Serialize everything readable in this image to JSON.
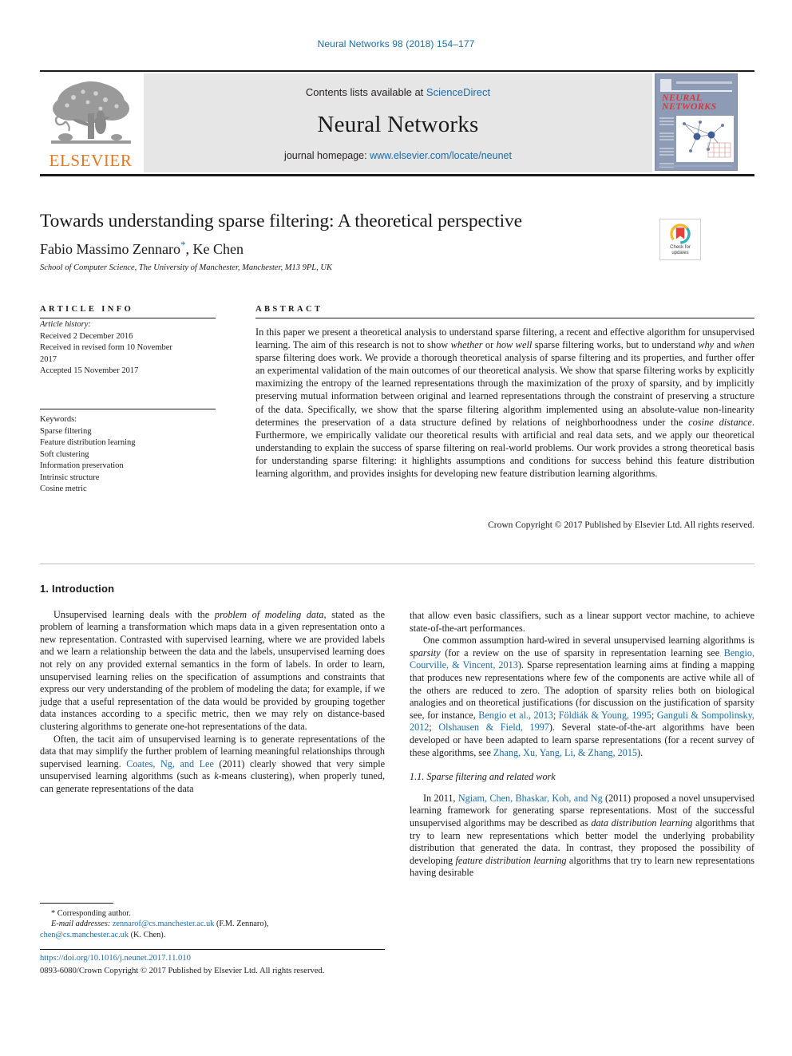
{
  "running_head": "Neural Networks 98 (2018) 154–177",
  "masthead": {
    "contents_prefix": "Contents lists available at ",
    "contents_link": "ScienceDirect",
    "journal_title": "Neural Networks",
    "homepage_prefix": "journal homepage: ",
    "homepage_url": "www.elsevier.com/locate/neunet",
    "publisher_logo_text": "ELSEVIER",
    "cover_title": "NEURAL NETWORKS"
  },
  "article": {
    "title": "Towards understanding sparse filtering: A theoretical perspective",
    "authors": "Fabio Massimo Zennaro",
    "corresponding_marker": "*",
    "authors_tail": ", Ke Chen",
    "affiliation": "School of Computer Science, The University of Manchester, Manchester, M13 9PL, UK",
    "crossmark_line1": "Check for",
    "crossmark_line2": "updates"
  },
  "article_info": {
    "heading": "ARTICLE INFO",
    "history_label": "Article history:",
    "history": [
      "Received 2 December 2016",
      "Received in revised form 10 November",
      "2017",
      "Accepted 15 November 2017"
    ],
    "keywords_label": "Keywords:",
    "keywords": [
      "Sparse filtering",
      "Feature distribution learning",
      "Soft clustering",
      "Information preservation",
      "Intrinsic structure",
      "Cosine metric"
    ]
  },
  "abstract": {
    "heading": "ABSTRACT",
    "paragraphs": [
      "In this paper we present a theoretical analysis to understand sparse filtering, a recent and effective algorithm for unsupervised learning. The aim of this research is not to show <i>whether</i> or <i>how well</i> sparse filtering works, but to understand <i>why</i> and <i>when</i> sparse filtering does work. We provide a thorough theoretical analysis of sparse filtering and its properties, and further offer an experimental validation of the main outcomes of our theoretical analysis. We show that sparse filtering works by explicitly maximizing the entropy of the learned representations through the maximization of the proxy of sparsity, and by implicitly preserving mutual information between original and learned representations through the constraint of preserving a structure of the data. Specifically, we show that the sparse filtering algorithm implemented using an absolute-value non-linearity determines the preservation of a data structure defined by relations of neighborhoodness under the <i>cosine distance</i>. Furthermore, we empirically validate our theoretical results with artificial and real data sets, and we apply our theoretical understanding to explain the success of sparse filtering on real-world problems. Our work provides a strong theoretical basis for understanding sparse filtering: it highlights assumptions and conditions for success behind this feature distribution learning algorithm, and provides insights for developing new feature distribution learning algorithms."
    ],
    "copyright": "Crown Copyright © 2017 Published by Elsevier Ltd. All rights reserved."
  },
  "body": {
    "section1_heading": "1. Introduction",
    "left_paragraphs": [
      "Unsupervised learning deals with the <i>problem of modeling data</i>, stated as the problem of learning a transformation which maps data in a given representation onto a new representation. Contrasted with supervised learning, where we are provided labels and we learn a relationship between the data and the labels, unsupervised learning does not rely on any provided external semantics in the form of labels. In order to learn, unsupervised learning relies on the specification of assumptions and constraints that express our very understanding of the problem of modeling the data; for example, if we judge that a useful representation of the data would be provided by grouping together data instances according to a specific metric, then we may rely on distance-based clustering algorithms to generate one-hot representations of the data.",
      "Often, the tacit aim of unsupervised learning is to generate representations of the data that may simplify the further problem of learning meaningful relationships through supervised learning. <span class=\"cit\">Coates, Ng, and Lee</span> (2011) clearly showed that very simple unsupervised learning algorithms (such as <i>k</i>-means clustering), when properly tuned, can generate representations of the data"
    ],
    "right_paragraphs": [
      "that allow even basic classifiers, such as a linear support vector machine, to achieve state-of-the-art performances.",
      "One common assumption hard-wired in several unsupervised learning algorithms is <i>sparsity</i> (for a review on the use of sparsity in representation learning see <span class=\"cit\">Bengio, Courville, &amp; Vincent, 2013</span>). Sparse representation learning aims at finding a mapping that produces new representations where few of the components are active while all of the others are reduced to zero. The adoption of sparsity relies both on biological analogies and on theoretical justifications (for discussion on the justification of sparsity see, for instance, <span class=\"cit\">Bengio et al., 2013</span>; <span class=\"cit\">Földiák &amp; Young, 1995</span>; <span class=\"cit\">Ganguli &amp; Sompolinsky, 2012</span>; <span class=\"cit\">Olshausen &amp; Field, 1997</span>). Several state-of-the-art algorithms have been developed or have been adapted to learn sparse representations (for a recent survey of these algorithms, see <span class=\"cit\">Zhang, Xu, Yang, Li, &amp; Zhang, 2015</span>)."
    ],
    "section11_heading": "1.1. Sparse filtering and related work",
    "right_paragraphs_2": [
      "In 2011, <span class=\"cit\">Ngiam, Chen, Bhaskar, Koh, and Ng</span> (2011) proposed a novel unsupervised learning framework for generating sparse representations. Most of the successful unsupervised algorithms may be described as <i>data distribution learning</i> algorithms that try to learn new representations which better model the underlying probability distribution that generated the data. In contrast, they proposed the possibility of developing <i>feature distribution learning</i> algorithms that try to learn new representations having desirable"
    ]
  },
  "footnotes": {
    "corresponding": "* Corresponding author.",
    "email_label": "E-mail addresses:",
    "email1": "zennarof@cs.manchester.ac.uk",
    "email1_owner": "(F.M. Zennaro),",
    "email2": "chen@cs.manchester.ac.uk",
    "email2_owner": "(K. Chen).",
    "doi": "https://doi.org/10.1016/j.neunet.2017.11.010",
    "issn_line": "0893-6080/Crown Copyright © 2017 Published by Elsevier Ltd. All rights reserved."
  },
  "colors": {
    "link": "#1b6ca8",
    "elsevier_orange": "#e87722",
    "masthead_bg": "#e6e6e6",
    "cover_bg": "#8d9bb4",
    "cover_title": "#d33a3a"
  }
}
